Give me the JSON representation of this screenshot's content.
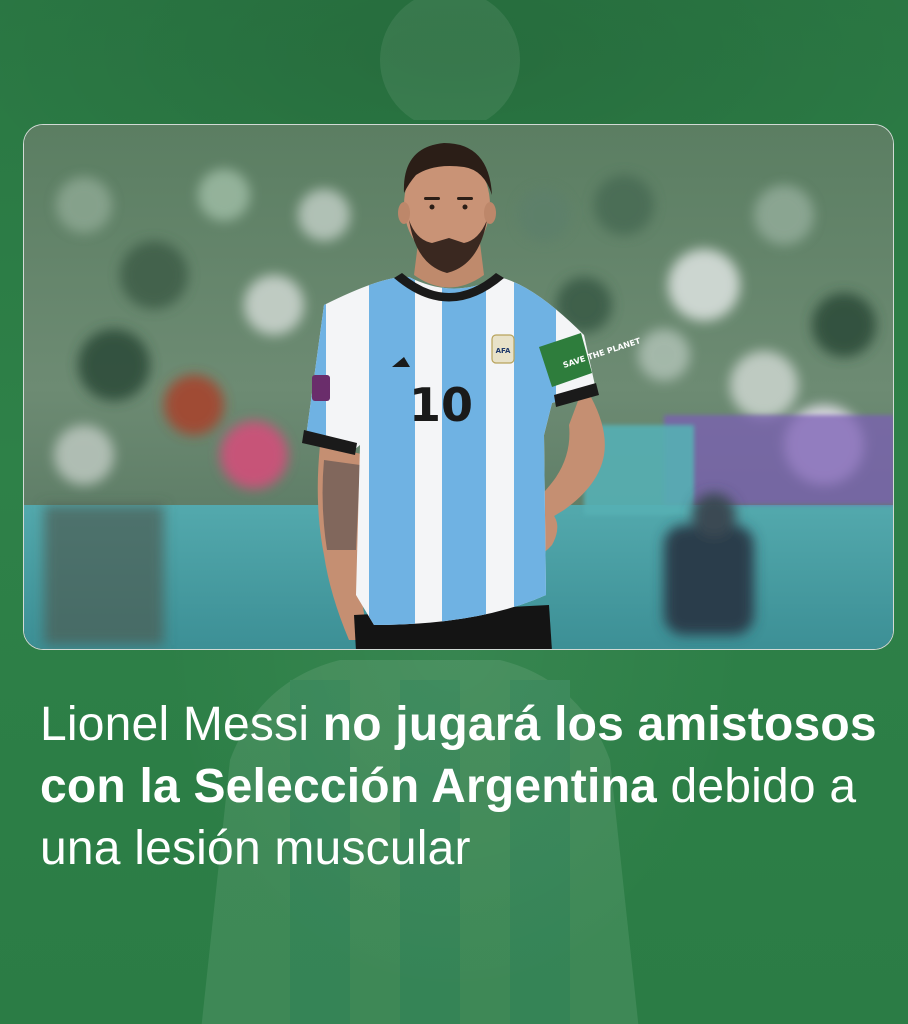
{
  "theme": {
    "background": "#2c7d45",
    "text": "#ffffff"
  },
  "photo": {
    "jersey_number": "10",
    "captain_band_text": "SAVE THE PLANET",
    "badge_text": "AFA"
  },
  "headline": {
    "part1": "Lionel Messi ",
    "part2_bold": "no jugará los amistosos con la Selección Argentina",
    "part3": " debido a una lesión muscular"
  }
}
